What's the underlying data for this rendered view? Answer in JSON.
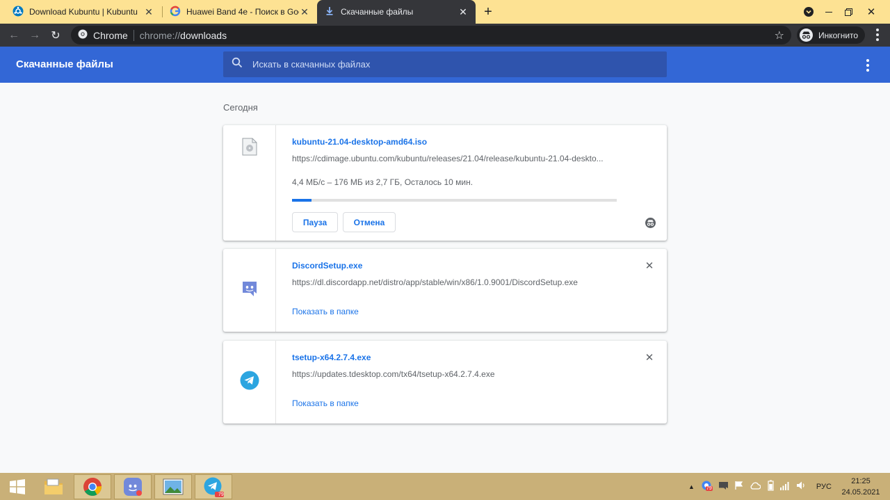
{
  "tabs": [
    {
      "title": "Download Kubuntu | Kubuntu",
      "icon": "kubuntu-icon"
    },
    {
      "title": "Huawei Band 4e - Поиск в Google",
      "icon": "google-icon"
    },
    {
      "title": "Скачанные файлы",
      "icon": "download-icon",
      "active": true
    }
  ],
  "toolbar": {
    "chip_label": "Chrome",
    "url_scheme": "chrome://",
    "url_path": "downloads",
    "incognito_label": "Инкогнито"
  },
  "header": {
    "title": "Скачанные файлы",
    "search_placeholder": "Искать в скачанных файлах"
  },
  "section": {
    "label": "Сегодня"
  },
  "downloads": [
    {
      "name": "kubuntu-21.04-desktop-amd64.iso",
      "url": "https://cdimage.ubuntu.com/kubuntu/releases/21.04/release/kubuntu-21.04-deskto...",
      "status": "4,4 МБ/с – 176 МБ из 2,7 ГБ, Осталось 10 мин.",
      "progress": 0.06,
      "pause_label": "Пауза",
      "cancel_label": "Отмена"
    },
    {
      "name": "DiscordSetup.exe",
      "url": "https://dl.discordapp.net/distro/app/stable/win/x86/1.0.9001/DiscordSetup.exe",
      "show_label": "Показать в папке"
    },
    {
      "name": "tsetup-x64.2.7.4.exe",
      "url": "https://updates.tdesktop.com/tx64/tsetup-x64.2.7.4.exe",
      "show_label": "Показать в папке"
    }
  ],
  "taskbar": {
    "telegram_badge": "79",
    "tray_badge": "79",
    "language": "РУС",
    "time": "21:25",
    "date": "24.05.2021"
  },
  "colors": {
    "header_blue": "#3367d6",
    "link_blue": "#1a73e8",
    "tabstrip_yellow": "#fde293",
    "toolbar_dark": "#35363a",
    "taskbar": "#c9b078"
  }
}
